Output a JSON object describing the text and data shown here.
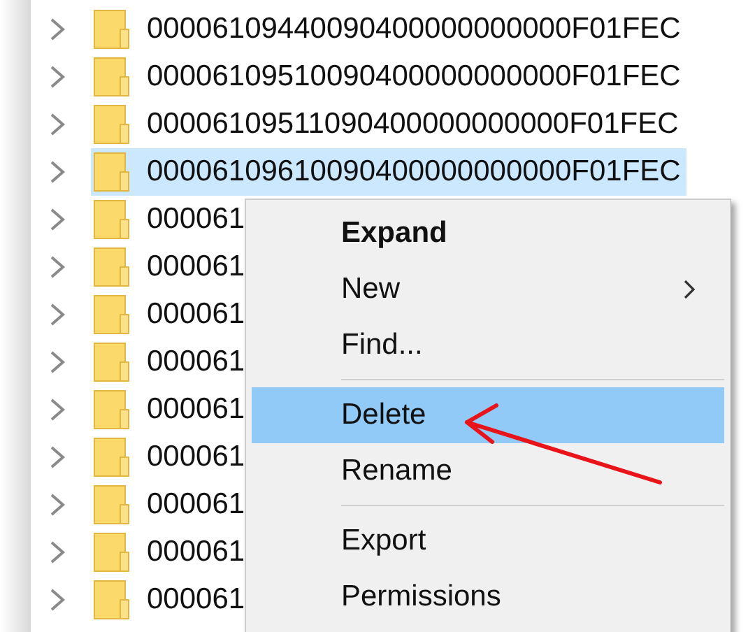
{
  "tree": {
    "rows": [
      {
        "label": "00006109440090400000000000F01FEC",
        "expanded": false,
        "selected": false
      },
      {
        "label": "00006109510090400000000000F01FEC",
        "expanded": false,
        "selected": false
      },
      {
        "label": "00006109511090400000000000F01FEC",
        "expanded": false,
        "selected": false
      },
      {
        "label": "00006109610090400000000000F01FEC",
        "expanded": false,
        "selected": true
      },
      {
        "label": "000061",
        "expanded": false,
        "selected": false
      },
      {
        "label": "000061",
        "expanded": false,
        "selected": false
      },
      {
        "label": "000061",
        "expanded": false,
        "selected": false
      },
      {
        "label": "000061",
        "expanded": false,
        "selected": false
      },
      {
        "label": "000061",
        "expanded": false,
        "selected": false
      },
      {
        "label": "000061",
        "expanded": false,
        "selected": false
      },
      {
        "label": "000061",
        "expanded": false,
        "selected": false
      },
      {
        "label": "000061",
        "expanded": false,
        "selected": false
      },
      {
        "label": "000061",
        "expanded": false,
        "selected": false
      }
    ]
  },
  "context_menu": {
    "items": [
      {
        "kind": "item",
        "label": "Expand",
        "default": true,
        "selected": false
      },
      {
        "kind": "submenu",
        "label": "New",
        "default": false,
        "selected": false
      },
      {
        "kind": "item",
        "label": "Find...",
        "default": false,
        "selected": false
      },
      {
        "kind": "separator"
      },
      {
        "kind": "item",
        "label": "Delete",
        "default": false,
        "selected": true
      },
      {
        "kind": "item",
        "label": "Rename",
        "default": false,
        "selected": false
      },
      {
        "kind": "separator"
      },
      {
        "kind": "item",
        "label": "Export",
        "default": false,
        "selected": false
      },
      {
        "kind": "item",
        "label": "Permissions",
        "default": false,
        "selected": false
      }
    ]
  }
}
